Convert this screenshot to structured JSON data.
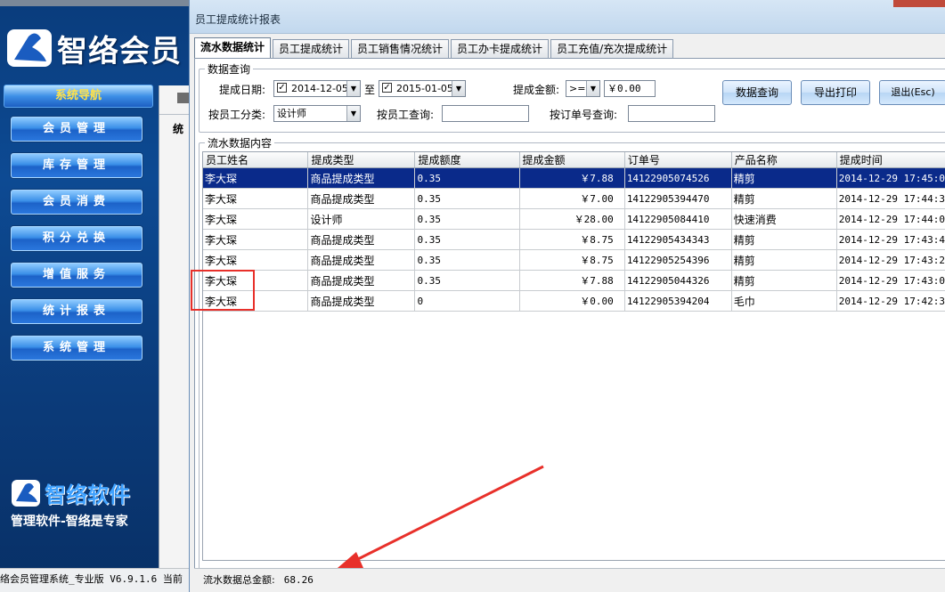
{
  "app": {
    "logo_text": "智络会员",
    "nav_header": "系统导航",
    "nav_items": [
      "会员管理",
      "库存管理",
      "会员消费",
      "积分兑换",
      "增值服务",
      "统计报表",
      "系统管理"
    ],
    "brand_name": "智络软件",
    "slogan": "管理软件-智络是专家",
    "status_text": "络会员管理系统_专业版 V6.9.1.6 当前",
    "partial_tab_label": "统"
  },
  "dialog": {
    "title": "员工提成统计报表",
    "tabs": [
      "流水数据统计",
      "员工提成统计",
      "员工销售情况统计",
      "员工办卡提成统计",
      "员工充值/充次提成统计"
    ],
    "active_tab": 0
  },
  "query": {
    "legend": "数据查询",
    "date_label": "提成日期:",
    "date_from": "2014-12-05",
    "date_to_label": "至",
    "date_to": "2015-01-05",
    "amount_label": "提成金额:",
    "amount_op": ">=",
    "amount_value": "￥0.00",
    "category_label": "按员工分类:",
    "category_value": "设计师",
    "employee_label": "按员工查询:",
    "employee_value": "",
    "order_label": "按订单号查询:",
    "order_value": "",
    "btn_query": "数据查询",
    "btn_export": "导出打印",
    "btn_exit": "退出(Esc)"
  },
  "grid": {
    "legend": "流水数据内容",
    "columns": [
      "员工姓名",
      "提成类型",
      "提成额度",
      "提成金额",
      "订单号",
      "产品名称",
      "提成时间"
    ],
    "rows": [
      [
        "李大琛",
        "商品提成类型",
        "0.35",
        "￥7.88",
        "14122905074526",
        "精剪",
        "2014-12-29 17:45:0"
      ],
      [
        "李大琛",
        "商品提成类型",
        "0.35",
        "￥7.00",
        "14122905394470",
        "精剪",
        "2014-12-29 17:44:3"
      ],
      [
        "李大琛",
        "设计师",
        "0.35",
        "￥28.00",
        "14122905084410",
        "快速消费",
        "2014-12-29 17:44:0"
      ],
      [
        "李大琛",
        "商品提成类型",
        "0.35",
        "￥8.75",
        "14122905434343",
        "精剪",
        "2014-12-29 17:43:4"
      ],
      [
        "李大琛",
        "商品提成类型",
        "0.35",
        "￥8.75",
        "14122905254396",
        "精剪",
        "2014-12-29 17:43:2"
      ],
      [
        "李大琛",
        "商品提成类型",
        "0.35",
        "￥7.88",
        "14122905044326",
        "精剪",
        "2014-12-29 17:43:0"
      ],
      [
        "李大琛",
        "商品提成类型",
        "0",
        "￥0.00",
        "14122905394204",
        "毛巾",
        "2014-12-29 17:42:3"
      ]
    ],
    "selected_row": 0
  },
  "footer": {
    "total_label": "流水数据总金额:",
    "total_value": "68.26"
  },
  "colors": {
    "selection": "#0a2a8a",
    "annotation": "#e8302a"
  }
}
